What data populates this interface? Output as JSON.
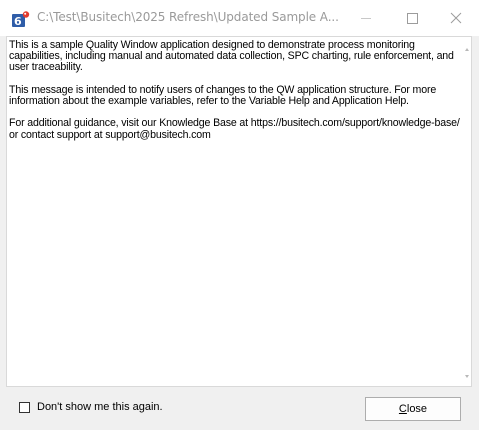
{
  "window": {
    "title": "C:\\Test\\Busitech\\2025 Refresh\\Updated Sample A..."
  },
  "message": {
    "paragraphs": [
      "This is a sample Quality Window application designed to demonstrate process monitoring capabilities, including manual and automated data collection, SPC charting, rule enforcement, and user traceability.",
      "This message is intended to notify users of changes to the QW application structure. For more information about the example variables, refer to the Variable Help and Application Help.",
      "For additional guidance, visit our Knowledge Base at https://busitech.com/support/knowledge-base/ or contact support at support@busitech.com"
    ]
  },
  "dont_show": {
    "label": "Don't show me this again.",
    "checked": false
  },
  "close_button": {
    "mnemonic": "C",
    "rest": "lose"
  },
  "colors": {
    "app_icon_bg": "#2f5da8",
    "app_icon_accent": "#e23b2e"
  }
}
